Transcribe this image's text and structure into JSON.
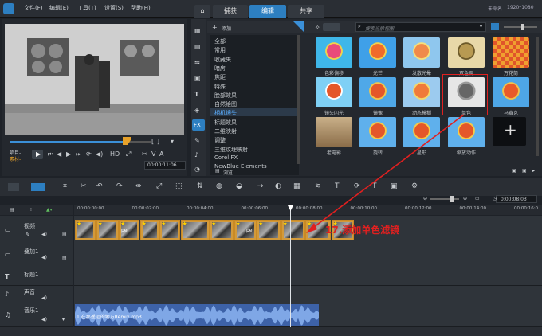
{
  "menu": {
    "file": "文件(F)",
    "edit": "编辑(E)",
    "tools": "工具(T)",
    "settings": "设置(S)",
    "help": "帮助(H)"
  },
  "tabs": {
    "home": "⌂",
    "capture": "捕获",
    "edit": "编辑",
    "share": "共享"
  },
  "project_info": {
    "name": "未命名",
    "resolution": "1920*1080"
  },
  "library": {
    "add_label": "添加",
    "search_placeholder": "搜索当前视图",
    "categories": [
      "全部",
      "常用",
      "收藏夹",
      "暗房",
      "焦距",
      "特殊",
      "脸部效果",
      "自然绘图",
      "相机镜头",
      "标题效果",
      "二维映射",
      "调整",
      "三维纹理映射",
      "Corel FX",
      "NewBlue Elements"
    ],
    "browse_label": "浏览",
    "filters": [
      "色彩偏移",
      "光芒",
      "发散光晕",
      "双色调",
      "万花筒",
      "镜头闪光",
      "镜像",
      "动态模糊",
      "单色",
      "马赛克",
      "老电影",
      "旋转",
      "星形",
      "缩放动作"
    ]
  },
  "player": {
    "project_label": "项目-",
    "clip_label": "素材-",
    "timecode": "00:00:11:06"
  },
  "timeline": {
    "zoom_time": "0:00:08:03",
    "ruler": [
      "00:00:00:00",
      "00:00:02:00",
      "00:00:04:00",
      "00:00:06:00",
      "00:00:08:00",
      "00:00:10:00",
      "00:00:12:00",
      "00:00:14:00",
      "00:00:16:0"
    ],
    "tracks": {
      "video": "视频",
      "overlay": "叠加1",
      "title": "标题1",
      "voice": "声音",
      "music": "音乐1"
    },
    "music_clip": "1.在那遥远的地方Remix.mp3",
    "clip_text": "pe"
  },
  "annotation": "17.添加单色滤镜",
  "colors": {
    "accent": "#2d7fc1",
    "annotation": "#e02020"
  }
}
